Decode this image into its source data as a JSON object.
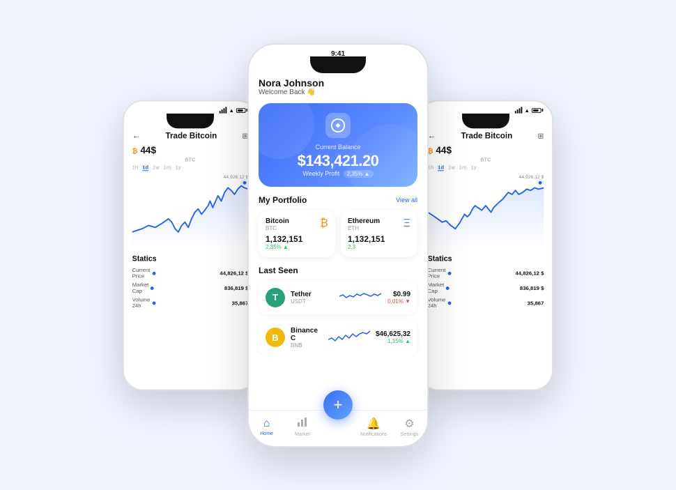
{
  "left_phone": {
    "status": {
      "time": "",
      "signal": true,
      "wifi": true,
      "battery": true
    },
    "header": {
      "back_icon": "←",
      "title": "Trade Bitcoin",
      "grid_icon": "⊞"
    },
    "btc": {
      "symbol": "₿",
      "price": "44$",
      "label": "BTC"
    },
    "time_tabs": [
      "1h",
      "1d",
      "1w",
      "1m",
      "1y"
    ],
    "active_tab": "1d",
    "chart_label": "44,926,12 $",
    "statics": {
      "title": "Statics",
      "rows": [
        {
          "label": "Current Price",
          "value": "44,826,12 $"
        },
        {
          "label": "Market Cap",
          "value": "836,819 $"
        },
        {
          "label": "Volume 24h",
          "value": "35,867"
        }
      ]
    }
  },
  "center_phone": {
    "status": {
      "time": "9:41"
    },
    "user": {
      "name": "Nora Johnson",
      "welcome": "Welcome Back 👋"
    },
    "balance_card": {
      "icon": "Ⓜ",
      "label": "Current Balance",
      "amount": "$143,421.20",
      "weekly_label": "Weekly Profit",
      "weekly_value": "2,35% ▲"
    },
    "portfolio": {
      "title": "My Portfolio",
      "view_all": "View all",
      "coins": [
        {
          "name": "Bitcoin",
          "ticker": "BTC",
          "icon": "₿",
          "amount": "1,132,151",
          "change": "2,35% ▲",
          "change_type": "positive"
        },
        {
          "name": "Ethereum",
          "ticker": "ETH",
          "icon": "Ξ",
          "amount": "1,132,151",
          "change": "2,3",
          "change_type": "positive"
        }
      ]
    },
    "last_seen": {
      "title": "Last Seen",
      "items": [
        {
          "name": "Tether",
          "ticker": "USDT",
          "logo": "T",
          "logo_class": "tether-logo",
          "price": "$0.99",
          "change": "0,01% ▼",
          "change_type": "negative"
        },
        {
          "name": "Binance C",
          "ticker": "BNB",
          "logo": "B",
          "logo_class": "bnb-logo",
          "price": "$46,625,32",
          "change": "1,15% ▲",
          "change_type": "positive"
        }
      ]
    },
    "nav": [
      {
        "icon": "🏠",
        "label": "Home",
        "active": true
      },
      {
        "icon": "📊",
        "label": "Market",
        "active": false
      },
      {
        "icon": "➕",
        "label": "",
        "active": false,
        "is_fab": true
      },
      {
        "icon": "🔔",
        "label": "Notifications",
        "active": false
      },
      {
        "icon": "⚙️",
        "label": "Settings",
        "active": false
      }
    ]
  },
  "right_phone": {
    "status": {
      "time": ""
    },
    "header": {
      "back_icon": "←",
      "title": "Trade Bitcoin",
      "grid_icon": "⊞"
    },
    "btc": {
      "symbol": "₿",
      "price": "44$",
      "label": "BTC"
    },
    "time_tabs": [
      "1h",
      "1d",
      "1w",
      "1m",
      "1y"
    ],
    "active_tab": "1d",
    "chart_label": "44,926,12 $",
    "statics": {
      "title": "Statics",
      "rows": [
        {
          "label": "Current Price",
          "value": "44,826,12 $"
        },
        {
          "label": "Market Cap",
          "value": "836,819 $"
        },
        {
          "label": "Volume 24h",
          "value": "35,867"
        }
      ]
    }
  },
  "colors": {
    "primary": "#2563eb",
    "positive": "#22c55e",
    "negative": "#ef4444",
    "btc_orange": "#f7931a",
    "eth_purple": "#627eea"
  }
}
